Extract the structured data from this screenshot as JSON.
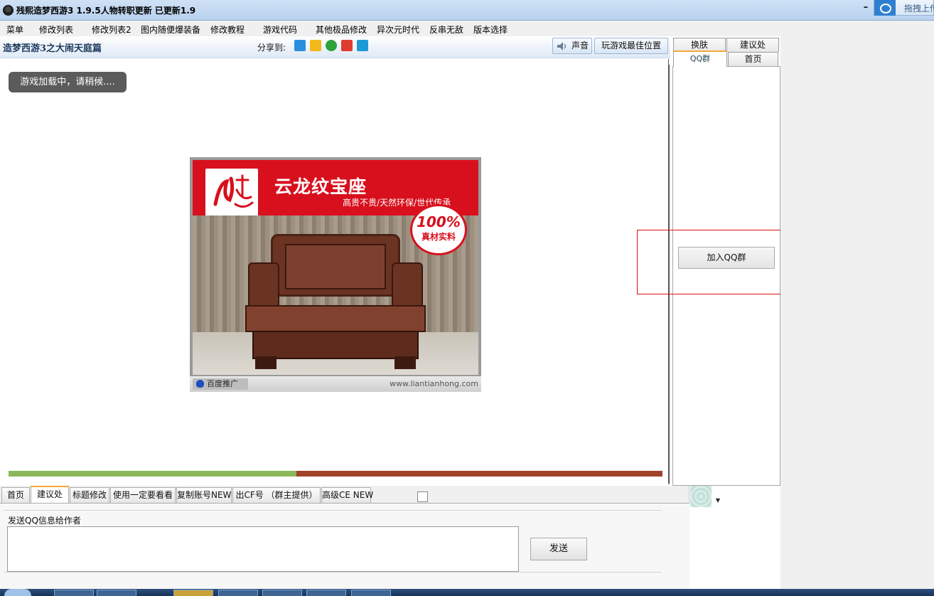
{
  "window": {
    "title": "残熙造梦西游3 1.9.5人物转职更新  已更新1.9",
    "minimize_glyph": "–",
    "cloud_label": "拖拽上传"
  },
  "menu": [
    "菜单",
    "修改列表",
    "修改列表2",
    "图内随便爆装备",
    "修改教程",
    "游戏代码",
    "其他极品修改",
    "异次元时代",
    "反串无敌",
    "版本选择"
  ],
  "header": {
    "title": "造梦西游3之大闹天庭篇",
    "share_label": "分享到:",
    "share_icons": [
      "qzone-icon",
      "pengyou-icon",
      "kaixin-icon",
      "weibo-icon",
      "qq-icon"
    ],
    "sound_label": "声音",
    "best_position_label": "玩游戏最佳位置"
  },
  "game": {
    "loading_text": "游戏加载中，请稍候....",
    "progress_fraction": 0.44,
    "progress_colors": {
      "fill": "#8cb85a",
      "track": "#a0432a"
    }
  },
  "ad": {
    "headline": "云龙纹宝座",
    "tagline": "高贵不贵/天然环保/世代传承",
    "seal_big": "100%",
    "seal_small": "真材实料",
    "badge": "百度推广",
    "url": "www.liantianhong.com",
    "brand_color": "#d8101d"
  },
  "side_panel": {
    "tabs_top": [
      "换肤",
      "建议处"
    ],
    "tabs_bottom": [
      "QQ群",
      "首页"
    ],
    "active_tab": "QQ群",
    "join_button": "加入QQ群"
  },
  "bottom": {
    "tabs": [
      "首页",
      "建议处",
      "标题修改",
      "使用一定要看看",
      "复制账号NEW",
      "出CF号 （群主提供）",
      "高级CE NEW"
    ],
    "active_tab": "建议处",
    "send_group_label": "发送QQ信息给作者",
    "message_value": "",
    "send_button": "发送"
  }
}
